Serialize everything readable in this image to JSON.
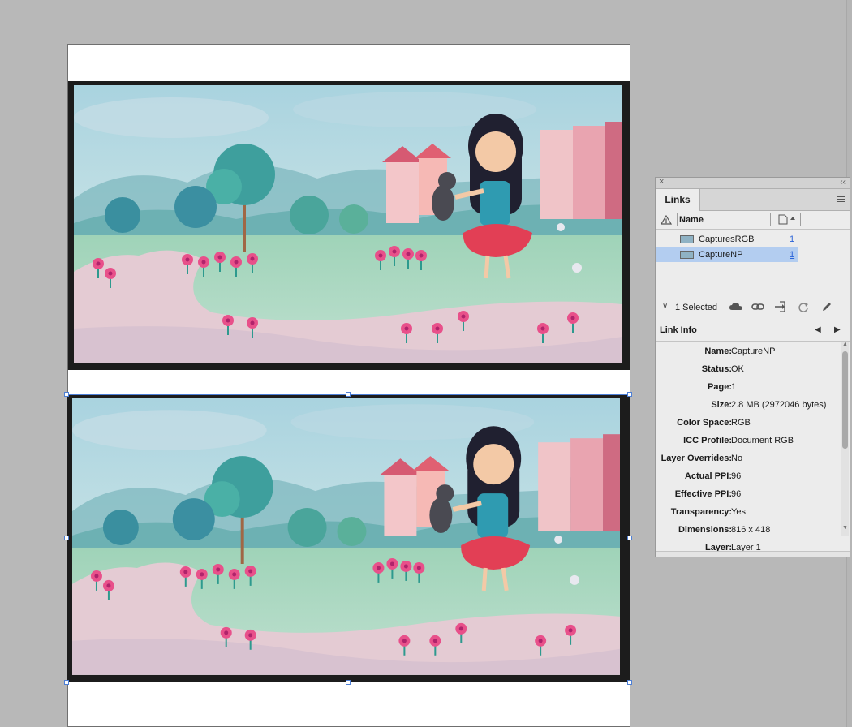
{
  "panel": {
    "title": "Links",
    "column_name": "Name",
    "links": [
      {
        "name": "CapturesRGB",
        "page": "1"
      },
      {
        "name": "CaptureNP",
        "page": "1"
      }
    ],
    "selected_text": "1 Selected",
    "info_title": "Link Info",
    "info": [
      {
        "label": "Name:",
        "value": "CaptureNP"
      },
      {
        "label": "Status:",
        "value": "OK"
      },
      {
        "label": "Page:",
        "value": "1"
      },
      {
        "label": "Size:",
        "value": "2.8 MB (2972046 bytes)"
      },
      {
        "label": "Color Space:",
        "value": "RGB"
      },
      {
        "label": "ICC Profile:",
        "value": "Document RGB"
      },
      {
        "label": "Layer Overrides:",
        "value": "No"
      },
      {
        "label": "Actual PPI:",
        "value": "96"
      },
      {
        "label": "Effective PPI:",
        "value": "96"
      },
      {
        "label": "Transparency:",
        "value": "Yes"
      },
      {
        "label": "Dimensions:",
        "value": "816 x 418"
      },
      {
        "label": "Layer:",
        "value": "Layer 1"
      }
    ]
  },
  "colors": {
    "selection": "#4d7fd6",
    "link_page": "#2b63d8",
    "selected_row": "#b3cdf0"
  }
}
